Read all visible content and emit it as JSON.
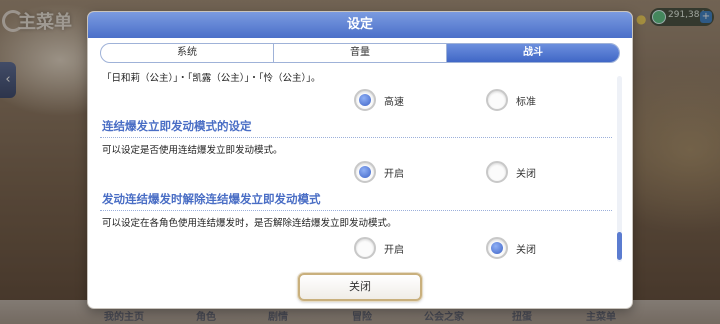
{
  "background": {
    "menu_label": "主菜单",
    "currency": "291,384",
    "bottom_nav": [
      "我的主页",
      "角色",
      "剧情",
      "冒险",
      "公会之家",
      "扭蛋",
      "主菜单"
    ]
  },
  "dialog": {
    "title": "设定",
    "tabs": [
      {
        "label": "系统",
        "active": false
      },
      {
        "label": "音量",
        "active": false
      },
      {
        "label": "战斗",
        "active": true
      }
    ],
    "partial_text": "「日和莉（公主）」・「凯露（公主）」・「怜（公主）」。",
    "speed_options": [
      {
        "label": "高速",
        "checked": true
      },
      {
        "label": "标准",
        "checked": false
      }
    ],
    "sections": [
      {
        "title": "连结爆发立即发动模式的设定",
        "description": "可以设定是否使用连结爆发立即发动模式。",
        "options": [
          {
            "label": "开启",
            "checked": true
          },
          {
            "label": "关闭",
            "checked": false
          }
        ]
      },
      {
        "title": "发动连结爆发时解除连结爆发立即发动模式",
        "description": "可以设定在各角色使用连结爆发时，是否解除连结爆发立即发动模式。",
        "options": [
          {
            "label": "开启",
            "checked": false
          },
          {
            "label": "关闭",
            "checked": true
          }
        ]
      }
    ],
    "close_label": "关闭"
  },
  "colors": {
    "header": "#5a7dd4",
    "section_title": "#4a6ec5",
    "radio_checked": "#3f64c7"
  }
}
